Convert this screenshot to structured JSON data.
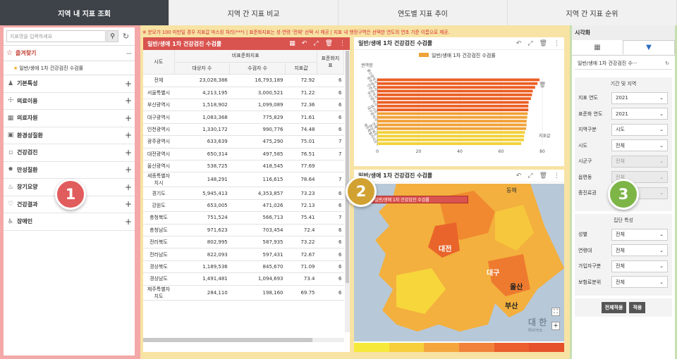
{
  "tabs": [
    "지역 내 지표 조회",
    "지역 간 지표 비교",
    "연도별 지표 추이",
    "지역 간 지표 순위"
  ],
  "left": {
    "search_placeholder": "지표명을 입력하세요",
    "favorites_label": "즐겨찾기",
    "favorite_item": "일반/생애 1차 건강검진 수검률",
    "categories": [
      "기본특성",
      "의료이용",
      "의료자원",
      "환경성질환",
      "건강검진",
      "만성질환",
      "장기요양",
      "건강결과",
      "장애인"
    ]
  },
  "notice": "※ 분모가 100 미만일 경우 지표값 마스킹 처리(***) | 표준화지표는 성·연령 '전체' 선택 시 제공 | 지표 내 행정구역은 선택한 연도의 연초 기준 이름으로 제공.",
  "table_panel": {
    "title": "일반/생애 1차 건강검진 수검률",
    "group_header": "비표준화지표",
    "headers": [
      "시도",
      "대상자 수",
      "수검자 수",
      "지표값",
      "표준화지표"
    ],
    "rows": [
      [
        "전체",
        "23,028,386",
        "16,793,189",
        "72.92",
        "6"
      ],
      [
        "서울특별시",
        "4,213,195",
        "3,000,521",
        "71.22",
        "6"
      ],
      [
        "부산광역시",
        "1,518,902",
        "1,099,089",
        "72.36",
        "6"
      ],
      [
        "대구광역시",
        "1,083,368",
        "775,829",
        "71.61",
        "6"
      ],
      [
        "인천광역시",
        "1,330,172",
        "990,776",
        "74.48",
        "6"
      ],
      [
        "광주광역시",
        "633,639",
        "475,290",
        "75.01",
        "7"
      ],
      [
        "대전광역시",
        "650,314",
        "497,585",
        "76.51",
        "7"
      ],
      [
        "울산광역시",
        "538,725",
        "418,545",
        "77.69",
        ""
      ],
      [
        "세종특별자치시",
        "148,291",
        "116,615",
        "78.64",
        "7"
      ],
      [
        "경기도",
        "5,945,413",
        "4,353,857",
        "73.23",
        "6"
      ],
      [
        "강원도",
        "653,005",
        "471,026",
        "72.13",
        "6"
      ],
      [
        "충청북도",
        "751,524",
        "566,713",
        "75.41",
        "7"
      ],
      [
        "충청남도",
        "971,623",
        "703,454",
        "72.4",
        "6"
      ],
      [
        "전라북도",
        "802,995",
        "587,935",
        "73.22",
        "6"
      ],
      [
        "전라남도",
        "822,093",
        "597,431",
        "72.67",
        "6"
      ],
      [
        "경상북도",
        "1,189,536",
        "845,670",
        "71.09",
        "6"
      ],
      [
        "경상남도",
        "1,491,481",
        "1,094,693",
        "73.4",
        "6"
      ],
      [
        "제주특별자치도",
        "284,110",
        "198,160",
        "69.75",
        "6"
      ]
    ]
  },
  "chart_panel": {
    "title": "일반/생애 1차 건강검진 수검률",
    "legend": "일반/생애 1차 건강검진 수검률",
    "region_label": "권역명",
    "ylabel_partial": "지표값",
    "ytick_labels": [
      "울산광역시",
      "광주광역시",
      "인천광역시",
      "부산광역시",
      "경기도",
      "대구광역시",
      "전체",
      "경상북도",
      "제주특별자치도"
    ]
  },
  "chart_data": {
    "type": "bar",
    "orientation": "horizontal",
    "categories": [
      "세종특별자치시",
      "울산광역시",
      "대전광역시",
      "충청북도",
      "광주광역시",
      "인천광역시",
      "경상남도",
      "경기도",
      "전라북도",
      "전체",
      "전라남도",
      "충청남도",
      "부산광역시",
      "강원도",
      "대구광역시",
      "서울특별시",
      "경상북도",
      "제주특별자치도"
    ],
    "values": [
      78.64,
      77.69,
      76.51,
      75.41,
      75.01,
      74.48,
      73.4,
      73.23,
      73.22,
      72.92,
      72.67,
      72.4,
      72.36,
      72.13,
      71.61,
      71.22,
      71.09,
      69.75
    ],
    "xlim": [
      0,
      80
    ],
    "xticks": [
      "0",
      "20",
      "40",
      "60",
      "80"
    ],
    "colors": [
      "#e8531e",
      "#f0a33a",
      "#f3d63a"
    ]
  },
  "map_panel": {
    "title": "일반/생애 1차 건강검진 수검률",
    "map_label": "일반/생애 1차 건강검진 수검률",
    "places": [
      "동해",
      "대전",
      "대구",
      "울산",
      "부산",
      "대 한",
      "Korea"
    ],
    "legend_colors": [
      "#f7e93a",
      "#f6cf3b",
      "#f4a63d",
      "#f0823b",
      "#eb5e2e",
      "#e5512a"
    ]
  },
  "right": {
    "title": "시각화",
    "indicator": "일반/생애 1차 건강검진 수···",
    "section1": "기간 및 지역",
    "section2": "집단 특성",
    "fields1": [
      [
        "지표 연도",
        "2021"
      ],
      [
        "표준화 연도",
        "2021"
      ],
      [
        "지역구분",
        "시도"
      ],
      [
        "시도",
        "전체"
      ],
      [
        "시군구",
        "전체"
      ],
      [
        "읍면동",
        "전체"
      ],
      [
        "중진료권",
        "전체"
      ]
    ],
    "fields2": [
      [
        "성별",
        "전체"
      ],
      [
        "연령대",
        "전체"
      ],
      [
        "가입자구분",
        "전체"
      ],
      [
        "보험료분위",
        "전체"
      ]
    ],
    "apply_all": "전체적용",
    "apply": "적용"
  },
  "badges": [
    "1",
    "2",
    "3"
  ]
}
